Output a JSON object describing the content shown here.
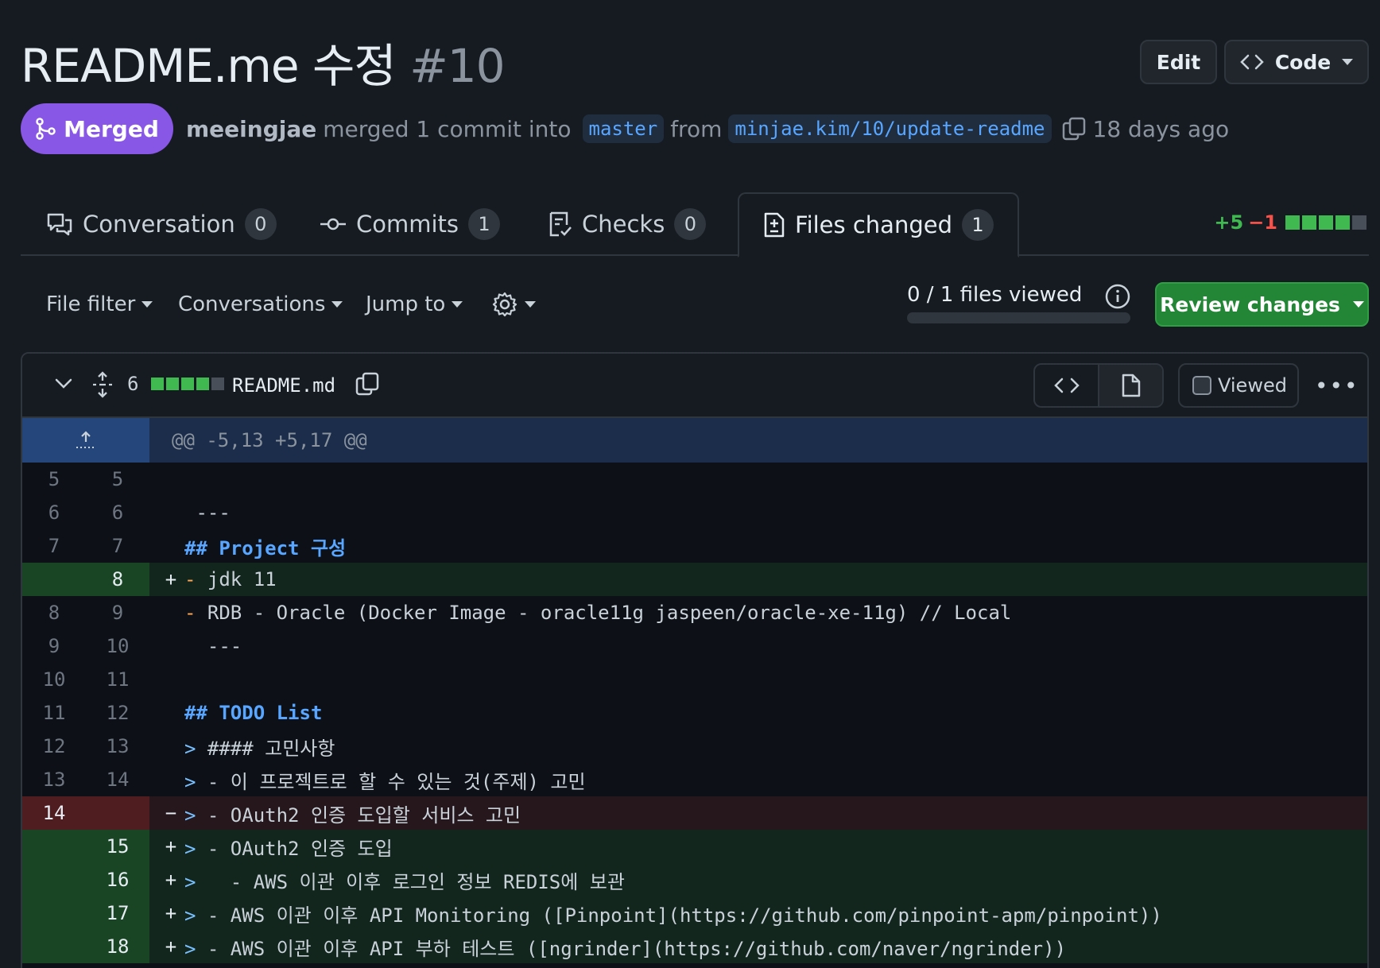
{
  "pr": {
    "title": "README.me 수정",
    "number": "#10",
    "state": "Merged",
    "author": "meeingjae",
    "action_text": "merged 1 commit into",
    "base_branch": "master",
    "from_text": "from",
    "head_branch": "minjae.kim/10/update-readme",
    "time": "18 days ago"
  },
  "header_buttons": {
    "edit": "Edit",
    "code": "Code"
  },
  "tabs": [
    {
      "label": "Conversation",
      "count": "0"
    },
    {
      "label": "Commits",
      "count": "1"
    },
    {
      "label": "Checks",
      "count": "0"
    },
    {
      "label": "Files changed",
      "count": "1"
    }
  ],
  "diffstat": {
    "additions": "+5",
    "deletions": "−1",
    "bar": [
      "green",
      "green",
      "green",
      "green",
      "neutral"
    ]
  },
  "toolbar": {
    "file_filter": "File filter",
    "conversations": "Conversations",
    "jump_to": "Jump to",
    "files_viewed": "0 / 1 files viewed",
    "viewed_progress": 0,
    "review_changes": "Review changes"
  },
  "file": {
    "changes": "6",
    "name": "README.md",
    "viewed_label": "Viewed",
    "hunk_header": "@@ -5,13 +5,17 @@"
  },
  "diff_lines": [
    {
      "type": "ctx",
      "old": "5",
      "new": "5",
      "sign": "",
      "text": ""
    },
    {
      "type": "ctx",
      "old": "6",
      "new": "6",
      "sign": "",
      "text": " ---"
    },
    {
      "type": "ctx",
      "old": "7",
      "new": "7",
      "sign": "",
      "text": "## Project 구성"
    },
    {
      "type": "add",
      "old": "",
      "new": "8",
      "sign": "+",
      "text": "- jdk 11"
    },
    {
      "type": "ctx",
      "old": "8",
      "new": "9",
      "sign": "",
      "text": "- RDB - Oracle (Docker Image - oracle11g jaspeen/oracle-xe-11g) // Local"
    },
    {
      "type": "ctx",
      "old": "9",
      "new": "10",
      "sign": "",
      "text": "  ---"
    },
    {
      "type": "ctx",
      "old": "10",
      "new": "11",
      "sign": "",
      "text": ""
    },
    {
      "type": "ctx",
      "old": "11",
      "new": "12",
      "sign": "",
      "text": "## TODO List"
    },
    {
      "type": "ctx",
      "old": "12",
      "new": "13",
      "sign": "",
      "text": "> #### 고민사항"
    },
    {
      "type": "ctx",
      "old": "13",
      "new": "14",
      "sign": "",
      "text": "> - 이 프로젝트로 할 수 있는 것(주제) 고민"
    },
    {
      "type": "del",
      "old": "14",
      "new": "",
      "sign": "−",
      "text": "> - OAuth2 인증 도입할 서비스 고민"
    },
    {
      "type": "add",
      "old": "",
      "new": "15",
      "sign": "+",
      "text": "> - OAuth2 인증 도입"
    },
    {
      "type": "add",
      "old": "",
      "new": "16",
      "sign": "+",
      "text": ">   - AWS 이관 이후 로그인 정보 REDIS에 보관"
    },
    {
      "type": "add",
      "old": "",
      "new": "17",
      "sign": "+",
      "text": "> - AWS 이관 이후 API Monitoring ([Pinpoint](https://github.com/pinpoint-apm/pinpoint))"
    },
    {
      "type": "add",
      "old": "",
      "new": "18",
      "sign": "+",
      "text": "> - AWS 이관 이후 API 부하 테스트 ([ngrinder](https://github.com/naver/ngrinder))"
    }
  ]
}
